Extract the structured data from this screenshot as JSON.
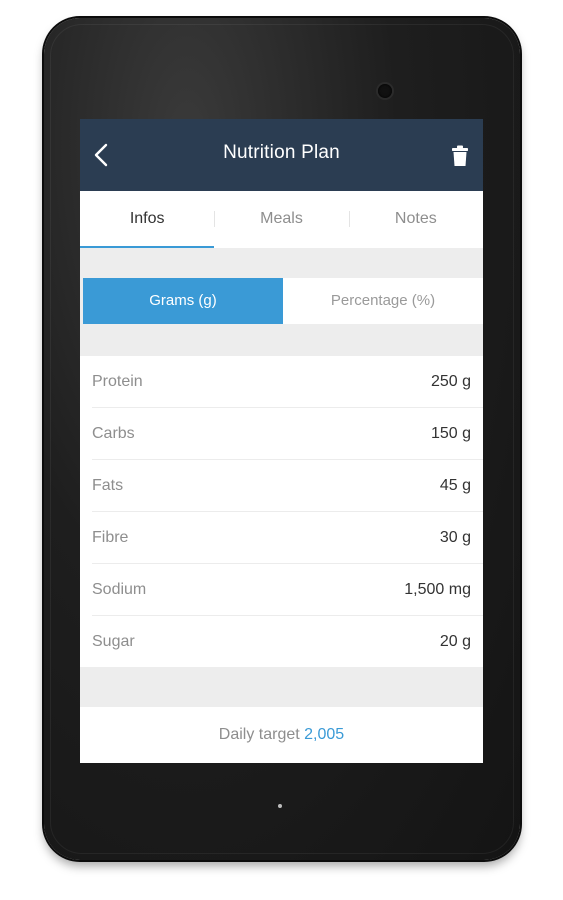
{
  "header": {
    "title": "Nutrition Plan",
    "back_icon": "chevron-left-icon",
    "delete_icon": "trash-icon"
  },
  "tabs": [
    {
      "label": "Infos",
      "active": true
    },
    {
      "label": "Meals",
      "active": false
    },
    {
      "label": "Notes",
      "active": false
    }
  ],
  "unit_toggle": {
    "options": [
      "Grams (g)",
      "Percentage (%)"
    ],
    "selected": "Grams (g)"
  },
  "nutrients": [
    {
      "label": "Protein",
      "value": "250 g"
    },
    {
      "label": "Carbs",
      "value": "150 g"
    },
    {
      "label": "Fats",
      "value": "45 g"
    },
    {
      "label": "Fibre",
      "value": "30 g"
    },
    {
      "label": "Sodium",
      "value": "1,500 mg"
    },
    {
      "label": "Sugar",
      "value": "20 g"
    }
  ],
  "footer": {
    "label": "Daily target",
    "value": "2,005"
  },
  "colors": {
    "app_bar": "#2b3d52",
    "accent": "#3a9ad6",
    "background": "#ededed"
  }
}
